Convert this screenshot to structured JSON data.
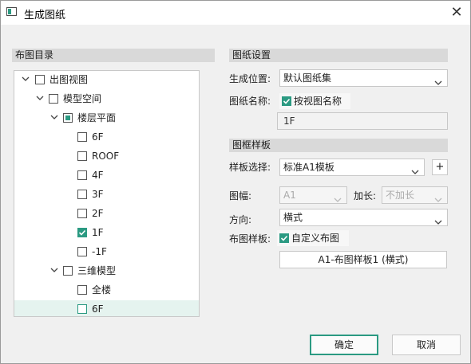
{
  "window": {
    "title": "生成图纸",
    "close_glyph": "✕"
  },
  "left": {
    "section_title": "布图目录",
    "tree": [
      {
        "label": "出图视图",
        "expanded": true,
        "state": "unchecked"
      },
      {
        "label": "模型空间",
        "expanded": true,
        "state": "unchecked"
      },
      {
        "label": "楼层平面",
        "expanded": true,
        "state": "partial"
      },
      {
        "label": "6F",
        "state": "unchecked"
      },
      {
        "label": "ROOF",
        "state": "unchecked"
      },
      {
        "label": "4F",
        "state": "unchecked"
      },
      {
        "label": "3F",
        "state": "unchecked"
      },
      {
        "label": "2F",
        "state": "unchecked"
      },
      {
        "label": "1F",
        "state": "checked"
      },
      {
        "label": "-1F",
        "state": "unchecked"
      },
      {
        "label": "三维模型",
        "expanded": true,
        "state": "unchecked"
      },
      {
        "label": "全楼",
        "state": "unchecked"
      },
      {
        "label": "6F",
        "state": "unchecked",
        "selected": true
      }
    ]
  },
  "right": {
    "drawing_settings": {
      "section_title": "图纸设置",
      "location_label": "生成位置:",
      "location_value": "默认图纸集",
      "name_label": "图纸名称:",
      "by_view_name_label": "按视图名称",
      "name_value": "1F"
    },
    "frame_template": {
      "section_title": "图框样板",
      "template_label": "样板选择:",
      "template_value": "标准A1模板",
      "add_button": "+",
      "size_label": "图幅:",
      "size_value": "A1",
      "extend_label": "加长:",
      "extend_value": "不加长",
      "orientation_label": "方向:",
      "orientation_value": "横式",
      "layout_label": "布图样板:",
      "custom_layout_label": "自定义布图",
      "layout_template_button": "A1-布图样板1 (横式)"
    }
  },
  "footer": {
    "ok": "确定",
    "cancel": "取消"
  },
  "colors": {
    "accent": "#2b9a82",
    "section_bg": "#d9d9d9",
    "selected_row": "#e5f3ef"
  }
}
